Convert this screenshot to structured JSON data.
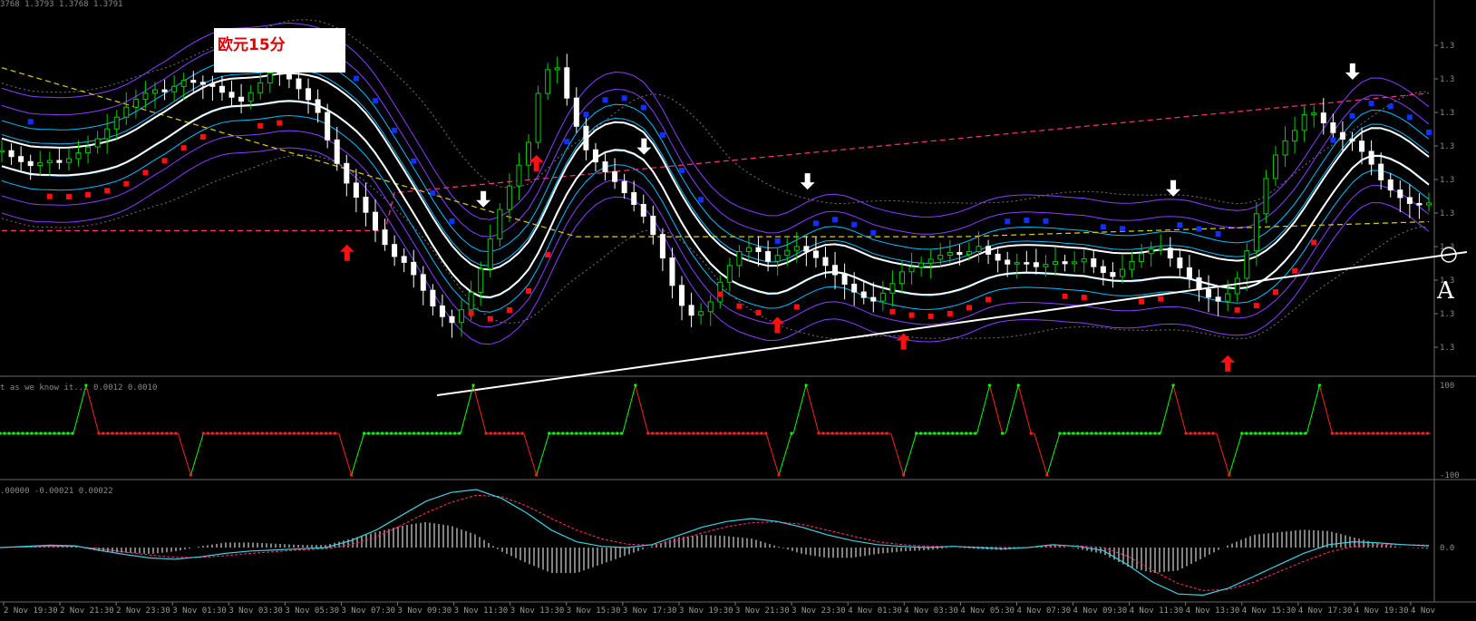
{
  "header": {
    "price_readout": "3768 1.3793 1.3768 1.3791",
    "title": "欧元15分",
    "panel2_info": "t as we know it... 0.0012 0.0010",
    "panel3_info": ".00000 -0.00021 0.00022",
    "annotation_a": "A"
  },
  "colors": {
    "background": "#000000",
    "bull_candle": "#00cc00",
    "bear_candle": "#ffffff",
    "inner_band": "#00bfff",
    "outer_band": "#8b3dff",
    "ma_dashed_yellow": "#e0d000",
    "ma_dashed_pink": "#ff3080",
    "trendline": "#ffffff",
    "dots_red": "#ff1010",
    "dots_blue": "#1030ff",
    "osc_up": "#00ff00",
    "osc_down": "#ff2020",
    "macd_line": "#3fd0e0",
    "signal_line": "#ff3080"
  },
  "chart_data": {
    "type": "candlestick",
    "instrument": "EURUSD 15m",
    "y_tick_labels": [
      "1.3",
      "1.3",
      "1.3",
      "1.3",
      "1.3",
      "1.3",
      "1.3",
      "1.3",
      "1.3",
      "1.3"
    ],
    "x_tick_labels": [
      "2 Nov 19:30",
      "2 Nov 21:30",
      "2 Nov 23:30",
      "3 Nov 01:30",
      "3 Nov 03:30",
      "3 Nov 05:30",
      "3 Nov 07:30",
      "3 Nov 09:30",
      "3 Nov 11:30",
      "3 Nov 13:30",
      "3 Nov 15:30",
      "3 Nov 17:30",
      "3 Nov 19:30",
      "3 Nov 21:30",
      "3 Nov 23:30",
      "4 Nov 01:30",
      "4 Nov 03:30",
      "4 Nov 05:30",
      "4 Nov 07:30",
      "4 Nov 09:30",
      "4 Nov 11:30",
      "4 Nov 13:30",
      "4 Nov 15:30",
      "4 Nov 17:30",
      "4 Nov 19:30",
      "4 Nov"
    ],
    "close_path": [
      0.61,
      0.58,
      0.56,
      0.58,
      0.57,
      0.6,
      0.63,
      0.68,
      0.74,
      0.78,
      0.81,
      0.8,
      0.84,
      0.83,
      0.82,
      0.79,
      0.77,
      0.82,
      0.87,
      0.85,
      0.8,
      0.74,
      0.6,
      0.5,
      0.43,
      0.34,
      0.27,
      0.24,
      0.16,
      0.08,
      0.05,
      0.12,
      0.24,
      0.4,
      0.52,
      0.62,
      0.87,
      0.88,
      0.72,
      0.6,
      0.55,
      0.5,
      0.44,
      0.38,
      0.26,
      0.12,
      0.07,
      0.1,
      0.2,
      0.28,
      0.3,
      0.25,
      0.28,
      0.3,
      0.27,
      0.23,
      0.18,
      0.14,
      0.12,
      0.16,
      0.22,
      0.24,
      0.26,
      0.28,
      0.27,
      0.3,
      0.26,
      0.24,
      0.25,
      0.23,
      0.25,
      0.24,
      0.26,
      0.22,
      0.2,
      0.24,
      0.28,
      0.3,
      0.25,
      0.2,
      0.14,
      0.12,
      0.16,
      0.3,
      0.5,
      0.62,
      0.67,
      0.75,
      0.7,
      0.65,
      0.64,
      0.58,
      0.5,
      0.46,
      0.43,
      0.44
    ],
    "arrows": {
      "down_white": [
        0.337,
        0.449,
        0.563,
        0.818,
        0.943
      ],
      "up_red": [
        0.242,
        0.374,
        0.542,
        0.63,
        0.856
      ]
    },
    "oscillator": {
      "range": [
        -100,
        100
      ],
      "peaks_up": [
        0.06,
        0.33,
        0.443,
        0.562,
        0.69,
        0.71,
        0.818,
        0.92
      ],
      "troughs_down": [
        0.133,
        0.245,
        0.374,
        0.543,
        0.63,
        0.73,
        0.857
      ]
    },
    "macd": {
      "y_label": "0.0",
      "line": [
        0.0,
        0.02,
        0.04,
        0.03,
        -0.05,
        -0.12,
        -0.18,
        -0.2,
        -0.16,
        -0.1,
        -0.06,
        -0.04,
        -0.02,
        0.0,
        0.12,
        0.3,
        0.55,
        0.8,
        0.95,
        1.0,
        0.85,
        0.6,
        0.3,
        0.1,
        0.02,
        0.0,
        0.05,
        0.2,
        0.35,
        0.45,
        0.5,
        0.45,
        0.35,
        0.22,
        0.12,
        0.05,
        0.02,
        0.0,
        0.02,
        0.0,
        -0.02,
        0.0,
        0.05,
        0.02,
        -0.05,
        -0.3,
        -0.6,
        -0.8,
        -0.82,
        -0.7,
        -0.5,
        -0.3,
        -0.1,
        0.05,
        0.1,
        0.08,
        0.05,
        0.03
      ],
      "signal": [
        0.0,
        0.01,
        0.02,
        0.02,
        -0.02,
        -0.08,
        -0.13,
        -0.17,
        -0.17,
        -0.14,
        -0.1,
        -0.07,
        -0.04,
        -0.02,
        0.05,
        0.18,
        0.38,
        0.6,
        0.78,
        0.9,
        0.88,
        0.72,
        0.5,
        0.3,
        0.15,
        0.06,
        0.04,
        0.12,
        0.25,
        0.36,
        0.43,
        0.44,
        0.4,
        0.3,
        0.2,
        0.1,
        0.05,
        0.02,
        0.02,
        0.01,
        0.0,
        0.0,
        0.03,
        0.03,
        0.0,
        -0.15,
        -0.4,
        -0.62,
        -0.74,
        -0.72,
        -0.6,
        -0.42,
        -0.24,
        -0.08,
        0.02,
        0.05,
        0.05,
        0.04
      ]
    }
  }
}
